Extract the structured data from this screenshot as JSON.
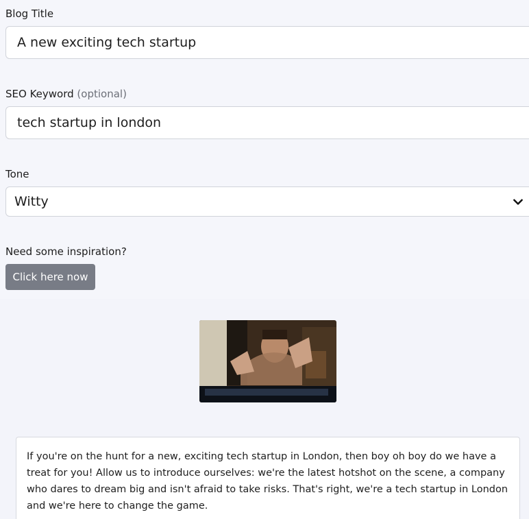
{
  "form": {
    "title_label": "Blog Title",
    "title_value": "A new exciting tech startup",
    "seo_label": "SEO Keyword",
    "seo_optional": "(optional)",
    "seo_value": "tech startup in london",
    "tone_label": "Tone",
    "tone_value": "Witty",
    "inspiration_label": "Need some inspiration?",
    "inspiration_button": "Click here now"
  },
  "result": {
    "gif_description": "reaction-gif",
    "text": "If you're on the hunt for a new, exciting tech startup in London, then boy oh boy do we have a treat for you! Allow us to introduce ourselves: we're the latest hotshot on the scene, a company who dares to dream big and isn't afraid to take risks. That's right, we're a tech startup in London and we're here to change the game."
  },
  "icons": {
    "select_arrow": "chevron-down-icon"
  },
  "colors": {
    "button_bg": "#787c86",
    "page_bg": "#f4f5fa"
  }
}
